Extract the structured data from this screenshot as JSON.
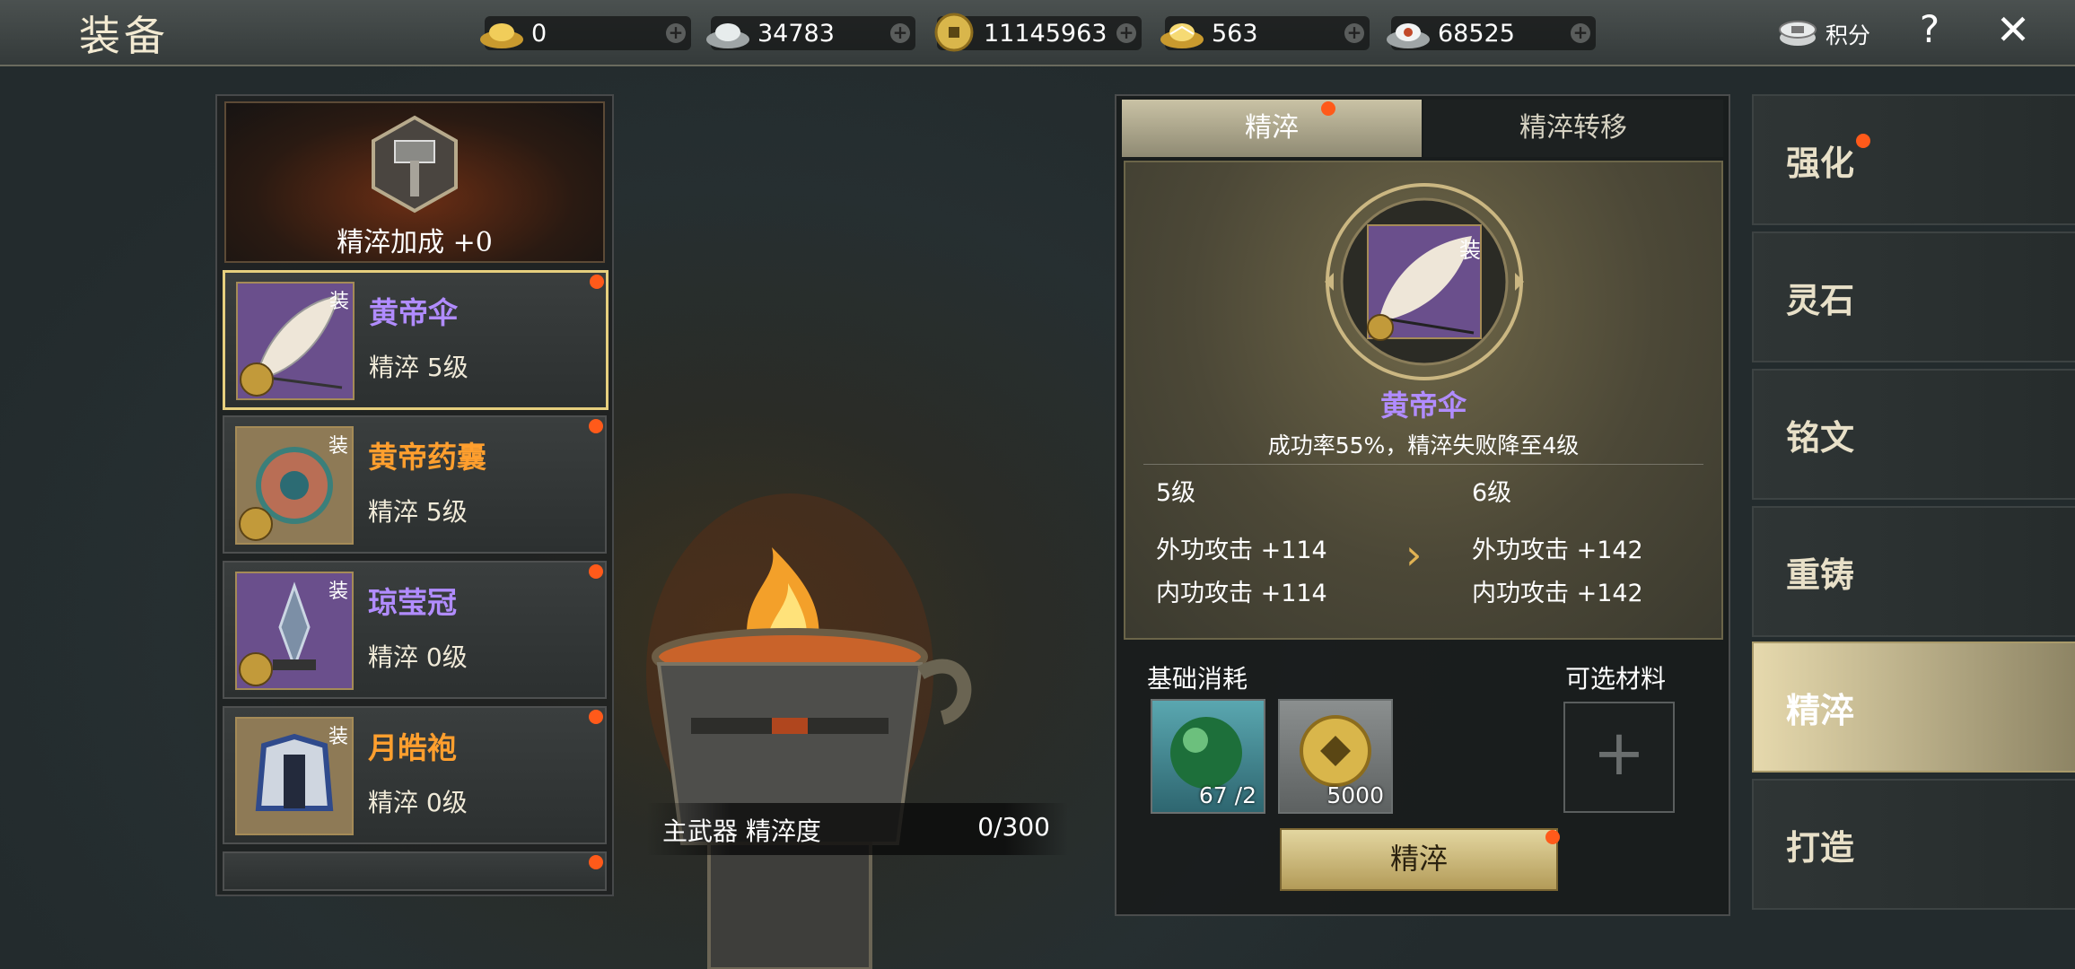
{
  "header": {
    "title": "装备",
    "score_label": "积分",
    "help": "?",
    "close": "✕"
  },
  "currencies": [
    {
      "icon": "gold-ingot-icon",
      "value": "0"
    },
    {
      "icon": "silver-ingot-icon",
      "value": "34783"
    },
    {
      "icon": "copper-coin-icon",
      "value": "11145963"
    },
    {
      "icon": "gold-ingot-bound-icon",
      "value": "563"
    },
    {
      "icon": "silver-ingot-bound-icon",
      "value": "68525"
    }
  ],
  "bonus": {
    "label": "精淬加成 +0"
  },
  "equipment": [
    {
      "name": "黄帝伞",
      "level": "精淬 5级",
      "tag": "装",
      "color": "#b18cff"
    },
    {
      "name": "黄帝药囊",
      "level": "精淬 5级",
      "tag": "装",
      "color": "#ff9f2e"
    },
    {
      "name": "琼莹冠",
      "level": "精淬 0级",
      "tag": "装",
      "color": "#b18cff"
    },
    {
      "name": "月皓袍",
      "level": "精淬 0级",
      "tag": "装",
      "color": "#ff9f2e"
    }
  ],
  "progress": {
    "label": "主武器 精淬度",
    "value": "0/300"
  },
  "tabs": [
    "精淬",
    "精淬转移"
  ],
  "detail": {
    "name": "黄帝伞",
    "tag": "装",
    "rate": "成功率55%，精淬失败降至4级",
    "cur_level": "5级",
    "next_level": "6级",
    "cur_stats": [
      "外功攻击 +114",
      "内功攻击 +114"
    ],
    "next_stats": [
      "外功攻击 +142",
      "内功攻击 +142"
    ]
  },
  "cost": {
    "base_label": "基础消耗",
    "optional_label": "可选材料",
    "materials": [
      {
        "icon": "jade-orb-icon",
        "count": "67 /2"
      },
      {
        "icon": "copper-coin-icon",
        "count": "5000"
      }
    ]
  },
  "action_button": "精淬",
  "side_menu": [
    "强化",
    "灵石",
    "铭文",
    "重铸",
    "精淬",
    "打造"
  ],
  "colors": {
    "accent_gold": "#e6cf7e",
    "notify": "#ff5a1a",
    "purple": "#b18cff",
    "orange": "#ff9f2e"
  }
}
